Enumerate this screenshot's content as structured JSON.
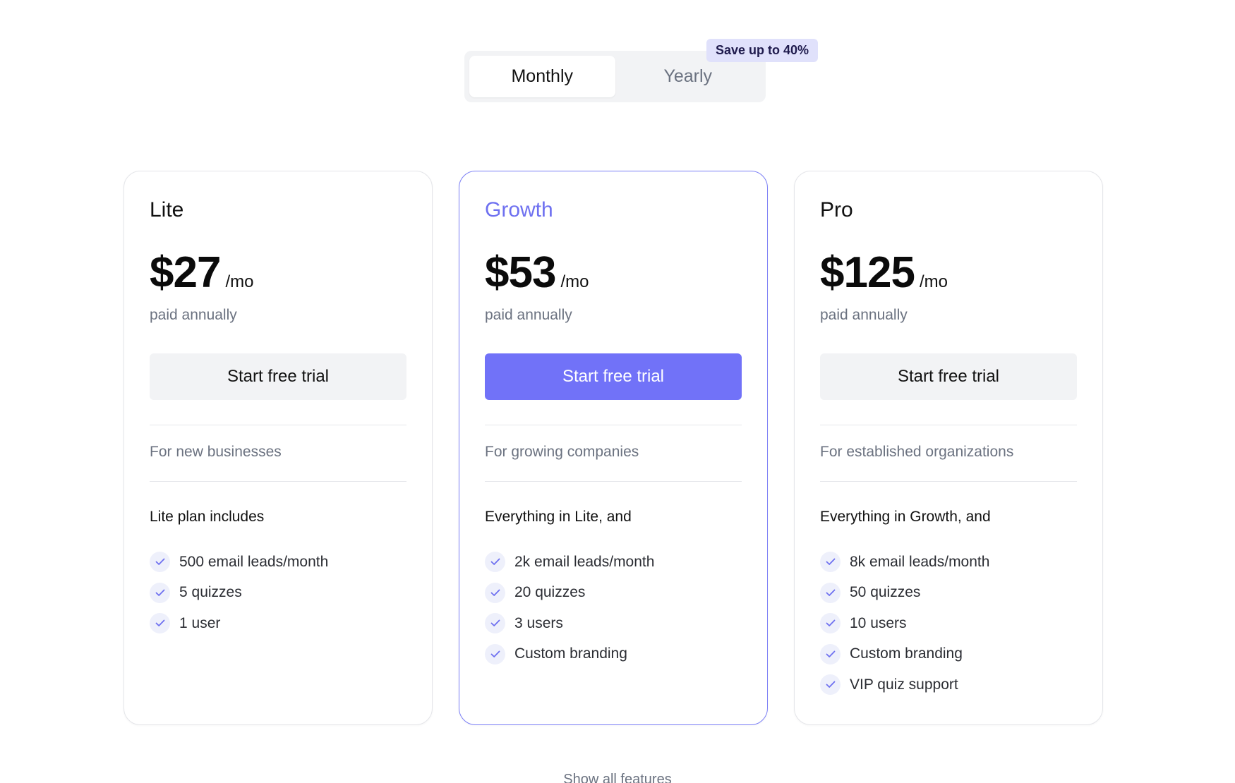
{
  "toggle": {
    "options": [
      "Monthly",
      "Yearly"
    ],
    "selected": "Monthly",
    "badge": "Save up to 40%"
  },
  "plans": [
    {
      "name": "Lite",
      "price": "$27",
      "period": "/mo",
      "billing": "paid annually",
      "cta": "Start free trial",
      "audience": "For new businesses",
      "includes_title": "Lite plan includes",
      "features": [
        "500 email leads/month",
        "5 quizzes",
        "1 user"
      ]
    },
    {
      "name": "Growth",
      "price": "$53",
      "period": "/mo",
      "billing": "paid annually",
      "cta": "Start free trial",
      "audience": "For growing companies",
      "includes_title": "Everything in Lite, and",
      "features": [
        "2k email leads/month",
        "20 quizzes",
        "3 users",
        "Custom branding"
      ]
    },
    {
      "name": "Pro",
      "price": "$125",
      "period": "/mo",
      "billing": "paid annually",
      "cta": "Start free trial",
      "audience": "For established organizations",
      "includes_title": "Everything in Growth, and",
      "features": [
        "8k email leads/month",
        "50 quizzes",
        "10 users",
        "Custom branding",
        "VIP quiz support"
      ]
    }
  ],
  "footer": {
    "show_all": "Show all features"
  },
  "colors": {
    "accent": "#7172f8",
    "check": "#6e70f0",
    "badge_bg": "#e0e1fb"
  },
  "icons": {
    "feature_check": "check-icon"
  }
}
